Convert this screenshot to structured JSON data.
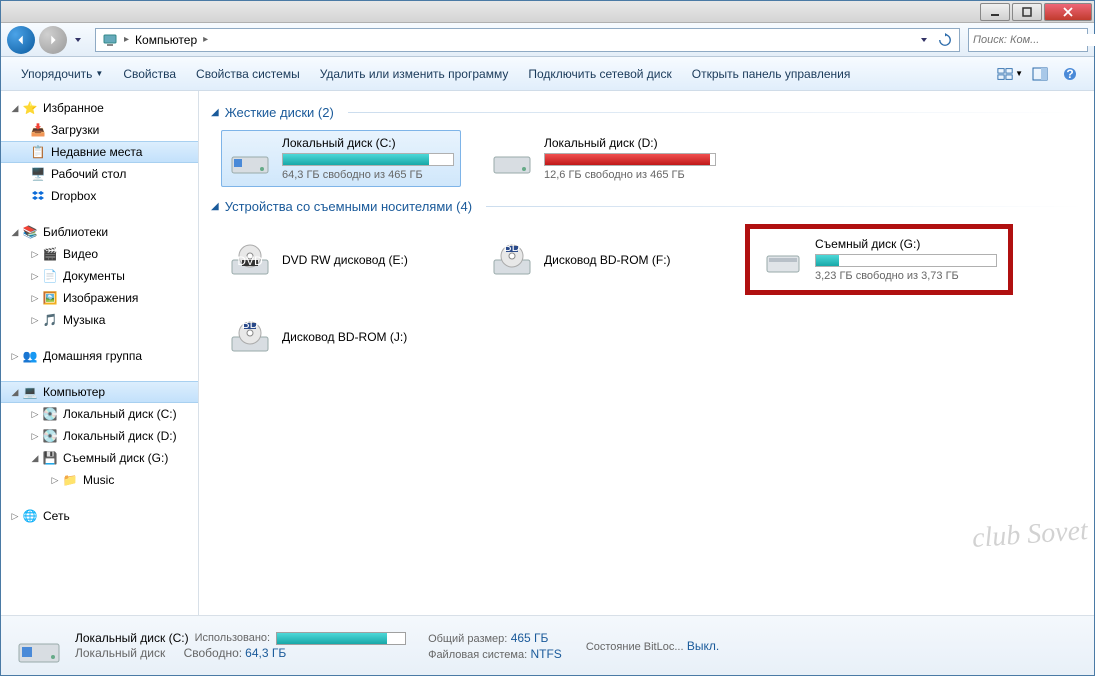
{
  "window": {
    "title": ""
  },
  "nav": {
    "breadcrumb_root": "Компьютер",
    "search_placeholder": "Поиск: Ком..."
  },
  "toolbar": {
    "organize": "Упорядочить",
    "properties": "Свойства",
    "system_properties": "Свойства системы",
    "uninstall": "Удалить или изменить программу",
    "map_drive": "Подключить сетевой диск",
    "control_panel": "Открыть панель управления"
  },
  "tree": {
    "favorites": "Избранное",
    "downloads": "Загрузки",
    "recent": "Недавние места",
    "desktop": "Рабочий стол",
    "dropbox": "Dropbox",
    "libraries": "Библиотеки",
    "videos": "Видео",
    "documents": "Документы",
    "pictures": "Изображения",
    "music": "Музыка",
    "homegroup": "Домашняя группа",
    "computer": "Компьютер",
    "local_c": "Локальный диск (C:)",
    "local_d": "Локальный диск (D:)",
    "removable_g": "Съемный диск (G:)",
    "music_folder": "Music",
    "network": "Сеть"
  },
  "groups": {
    "hard_disks": "Жесткие диски (2)",
    "removable": "Устройства со съемными носителями (4)"
  },
  "drives": {
    "c": {
      "name": "Локальный диск (C:)",
      "sub": "64,3 ГБ свободно из 465 ГБ",
      "fill": 86
    },
    "d": {
      "name": "Локальный диск (D:)",
      "sub": "12,6 ГБ свободно из 465 ГБ",
      "fill": 97
    },
    "dvd_e": {
      "name": "DVD RW дисковод (E:)"
    },
    "bd_f": {
      "name": "Дисковод BD-ROM (F:)"
    },
    "bd_j": {
      "name": "Дисковод BD-ROM (J:)"
    },
    "g": {
      "name": "Съемный диск (G:)",
      "sub": "3,23 ГБ свободно из 3,73 ГБ",
      "fill": 13
    }
  },
  "details": {
    "title": "Локальный диск (C:)",
    "type": "Локальный диск",
    "used_label": "Использовано:",
    "free_label": "Свободно:",
    "free_value": "64,3 ГБ",
    "total_label": "Общий размер:",
    "total_value": "465 ГБ",
    "fs_label": "Файловая система:",
    "fs_value": "NTFS",
    "bitlocker_label": "Состояние BitLoc...",
    "bitlocker_value": "Выкл.",
    "used_fill": 86
  },
  "watermark": "club Sovet"
}
